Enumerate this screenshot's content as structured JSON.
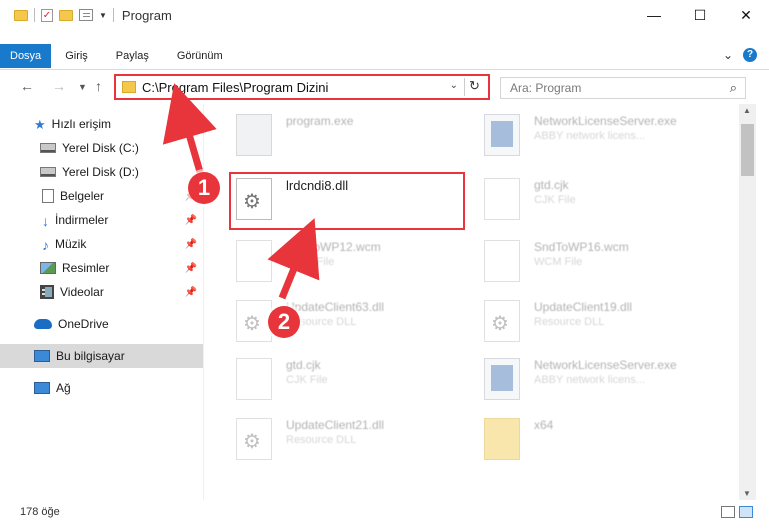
{
  "window": {
    "title": "Program"
  },
  "ribbon": {
    "tabs": [
      {
        "label": "Dosya",
        "active": true
      },
      {
        "label": "Giriş"
      },
      {
        "label": "Paylaş"
      },
      {
        "label": "Görünüm"
      }
    ]
  },
  "address": {
    "path": "C:\\Program Files\\Program Dizini"
  },
  "search": {
    "placeholder": "Ara: Program"
  },
  "sidebar": {
    "items": [
      {
        "label": "Hızlı erişim",
        "icon": "star-icon"
      },
      {
        "label": "Yerel Disk (C:)",
        "icon": "drive-icon"
      },
      {
        "label": "Yerel Disk (D:)",
        "icon": "drive-icon"
      },
      {
        "label": "Belgeler",
        "icon": "documents-icon",
        "pinned": true
      },
      {
        "label": "İndirmeler",
        "icon": "download-icon",
        "pinned": true
      },
      {
        "label": "Müzik",
        "icon": "music-icon",
        "pinned": true
      },
      {
        "label": "Resimler",
        "icon": "pictures-icon",
        "pinned": true
      },
      {
        "label": "Videolar",
        "icon": "video-icon",
        "pinned": true
      },
      {
        "label": "OneDrive",
        "icon": "cloud-icon"
      },
      {
        "label": "Bu bilgisayar",
        "icon": "computer-icon",
        "selected": true
      },
      {
        "label": "Ağ",
        "icon": "network-icon"
      }
    ]
  },
  "files": [
    {
      "name": "program.exe",
      "type": ""
    },
    {
      "name": "NetworkLicenseServer.exe",
      "type": "ABBY network licens..."
    },
    {
      "name": "lrdcndi8.dll",
      "type": ""
    },
    {
      "name": "gtd.cjk",
      "type": "CJK File"
    },
    {
      "name": "SndToWP12.wcm",
      "type": "WCM File"
    },
    {
      "name": "SndToWP16.wcm",
      "type": "WCM File"
    },
    {
      "name": "UpdateClient63.dll",
      "type": "Resource DLL"
    },
    {
      "name": "UpdateClient19.dll",
      "type": "Resource DLL"
    },
    {
      "name": "gtd.cjk",
      "type": "CJK File"
    },
    {
      "name": "NetworkLicenseServer.exe",
      "type": "ABBY network licens..."
    },
    {
      "name": "UpdateClient21.dll",
      "type": "Resource DLL"
    },
    {
      "name": "x64",
      "type": ""
    }
  ],
  "status": {
    "item_count": "178 öğe"
  },
  "annotations": {
    "step1": "1",
    "step2": "2"
  },
  "colors": {
    "accent": "#1979ca",
    "highlight": "#e8343b"
  }
}
